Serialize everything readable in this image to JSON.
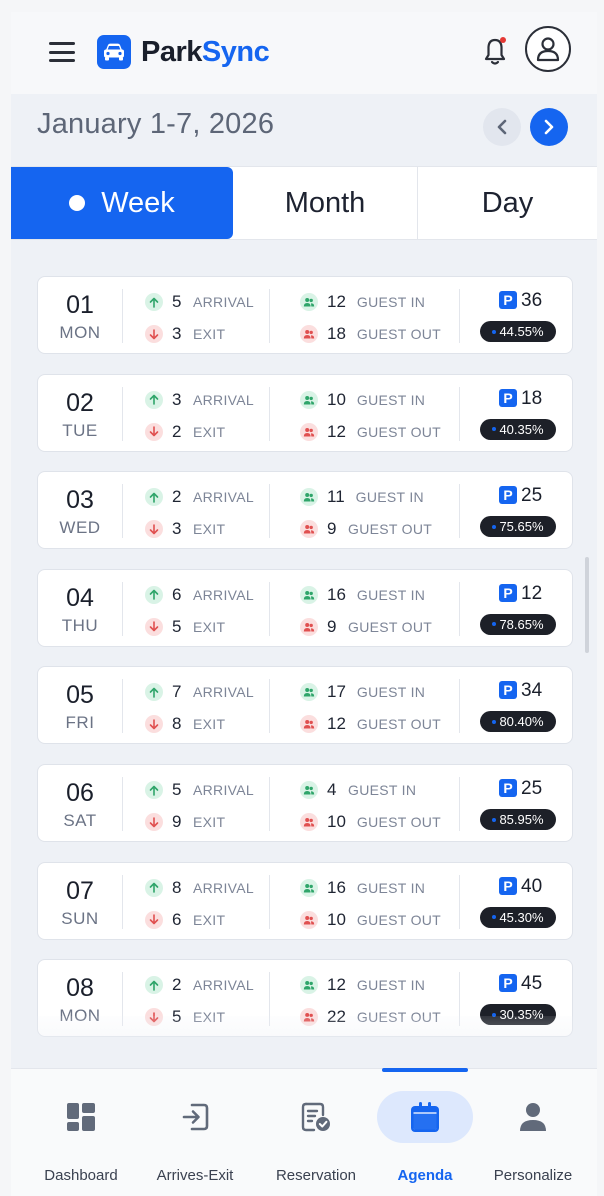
{
  "app": {
    "name_part1": "Park",
    "name_part2": "Sync"
  },
  "date_range": "January 1-7, 2026",
  "tabs": [
    {
      "label": "Week",
      "active": true
    },
    {
      "label": "Month",
      "active": false
    },
    {
      "label": "Day",
      "active": false
    }
  ],
  "labels": {
    "arrival": "ARRIVAL",
    "exit": "EXIT",
    "guest_in": "GUEST IN",
    "guest_out": "GUEST OUT",
    "parking_badge": "P"
  },
  "days": [
    {
      "day": "01",
      "weekday": "MON",
      "arrival": "5",
      "exit": "3",
      "guest_in": "12",
      "guest_out": "18",
      "parking": "36",
      "occupancy": "44.55%"
    },
    {
      "day": "02",
      "weekday": "TUE",
      "arrival": "3",
      "exit": "2",
      "guest_in": "10",
      "guest_out": "12",
      "parking": "18",
      "occupancy": "40.35%"
    },
    {
      "day": "03",
      "weekday": "WED",
      "arrival": "2",
      "exit": "3",
      "guest_in": "11",
      "guest_out": "9",
      "parking": "25",
      "occupancy": "75.65%"
    },
    {
      "day": "04",
      "weekday": "THU",
      "arrival": "6",
      "exit": "5",
      "guest_in": "16",
      "guest_out": "9",
      "parking": "12",
      "occupancy": "78.65%"
    },
    {
      "day": "05",
      "weekday": "FRI",
      "arrival": "7",
      "exit": "8",
      "guest_in": "17",
      "guest_out": "12",
      "parking": "34",
      "occupancy": "80.40%"
    },
    {
      "day": "06",
      "weekday": "SAT",
      "arrival": "5",
      "exit": "9",
      "guest_in": "4",
      "guest_out": "10",
      "parking": "25",
      "occupancy": "85.95%"
    },
    {
      "day": "07",
      "weekday": "SUN",
      "arrival": "8",
      "exit": "6",
      "guest_in": "16",
      "guest_out": "10",
      "parking": "40",
      "occupancy": "45.30%"
    },
    {
      "day": "08",
      "weekday": "MON",
      "arrival": "2",
      "exit": "5",
      "guest_in": "12",
      "guest_out": "22",
      "parking": "45",
      "occupancy": "30.35%"
    }
  ],
  "bottom_nav": [
    {
      "label": "Dashboard",
      "icon": "dashboard-icon",
      "active": false
    },
    {
      "label": "Arrives-Exit",
      "icon": "login-icon",
      "active": false
    },
    {
      "label": "Reservation",
      "icon": "reservation-icon",
      "active": false
    },
    {
      "label": "Agenda",
      "icon": "calendar-icon",
      "active": true
    },
    {
      "label": "Personalize",
      "icon": "person-icon",
      "active": false
    }
  ],
  "colors": {
    "accent": "#1565f0",
    "arrival_bg": "#d9f3e6",
    "exit_bg": "#fbdede",
    "pill_bg": "#1d2028"
  }
}
